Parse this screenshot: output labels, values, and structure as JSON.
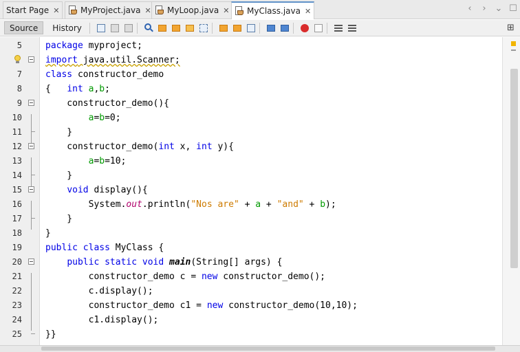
{
  "tabs": [
    {
      "label": "Start Page",
      "close": "✕",
      "active": false,
      "icon": "none"
    },
    {
      "label": "MyProject.java",
      "close": "✕",
      "active": false,
      "icon": "java-file-icon"
    },
    {
      "label": "MyLoop.java",
      "close": "✕",
      "active": false,
      "icon": "java-file-icon"
    },
    {
      "label": "MyClass.java",
      "close": "✕",
      "active": true,
      "icon": "java-file-icon"
    }
  ],
  "tab_nav": {
    "prev": "‹",
    "next": "›",
    "dropdown": "⌄",
    "maximize": "☐"
  },
  "toolbar": {
    "source_label": "Source",
    "history_label": "History",
    "icons": [
      "last-edit-icon",
      "back-icon",
      "forward-icon",
      "search-icon",
      "find-prev-icon",
      "find-next-icon",
      "toggle-highlight-icon",
      "select-icon",
      "prev-bookmark-icon",
      "next-bookmark-icon",
      "toggle-bookmark-icon",
      "shift-left-icon",
      "shift-right-icon",
      "record-macro-icon",
      "stop-macro-icon",
      "comment-icon",
      "uncomment-icon"
    ],
    "split_icon": "⊞"
  },
  "editor": {
    "accent_colors": {
      "keyword": "#0000e6",
      "field": "#009900",
      "parameter": "#b0006b",
      "string": "#ce7b00"
    },
    "lines": [
      {
        "num": "5",
        "text": "package myproject;"
      },
      {
        "num": "6",
        "text": "import java.util.Scanner;"
      },
      {
        "num": "7",
        "text": "class constructor_demo"
      },
      {
        "num": "8",
        "text": "{   int a,b;"
      },
      {
        "num": "9",
        "text": "    constructor_demo(){"
      },
      {
        "num": "10",
        "text": "        a=b=0;"
      },
      {
        "num": "11",
        "text": "    }"
      },
      {
        "num": "12",
        "text": "    constructor_demo(int x, int y){"
      },
      {
        "num": "13",
        "text": "        a=b=10;"
      },
      {
        "num": "14",
        "text": "    }"
      },
      {
        "num": "15",
        "text": "    void display(){"
      },
      {
        "num": "16",
        "text": "        System.out.println(\"Nos are\" + a + \"and\" + b);"
      },
      {
        "num": "17",
        "text": "    }"
      },
      {
        "num": "18",
        "text": "}"
      },
      {
        "num": "19",
        "text": "public class MyClass {"
      },
      {
        "num": "20",
        "text": "    public static void main(String[] args) {"
      },
      {
        "num": "21",
        "text": "        constructor_demo c = new constructor_demo();"
      },
      {
        "num": "22",
        "text": "        c.display();"
      },
      {
        "num": "23",
        "text": "        constructor_demo c1 = new constructor_demo(10,10);"
      },
      {
        "num": "24",
        "text": "        c1.display();"
      },
      {
        "num": "25",
        "text": "}}"
      }
    ]
  }
}
